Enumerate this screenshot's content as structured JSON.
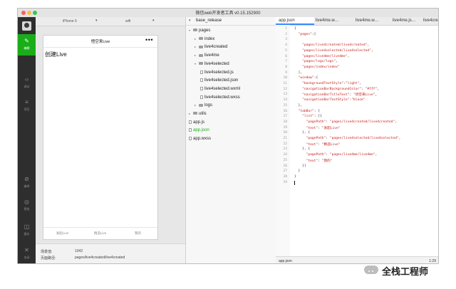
{
  "window": {
    "title": "微信web开发者工具 v0.15.152900"
  },
  "leftbar": {
    "items": [
      {
        "icon": "edit-icon",
        "label": "编辑",
        "glyph": "✎",
        "active": true
      },
      {
        "icon": "code-icon",
        "label": "调试",
        "glyph": "‹›",
        "active": false
      },
      {
        "icon": "menu-icon",
        "label": "项目",
        "glyph": "≡",
        "active": false
      },
      {
        "icon": "compile-icon",
        "label": "编译",
        "glyph": "⊘",
        "active": false
      },
      {
        "icon": "preview-icon",
        "label": "预览",
        "glyph": "◎",
        "active": false
      },
      {
        "icon": "layers-icon",
        "label": "缓存",
        "glyph": "◫",
        "active": false
      },
      {
        "icon": "close-icon",
        "label": "关闭",
        "glyph": "✕",
        "active": false
      }
    ]
  },
  "simulator": {
    "device": "iPhone 6",
    "network": "wifi",
    "nav_title": "悟空来Live",
    "nav_dots": "•••",
    "page_text": "创建Live",
    "tabs": [
      "发起Live",
      "精选Live",
      "我的"
    ]
  },
  "status": {
    "scene_label": "场景值:",
    "scene_value": "1042",
    "path_label": "页面路径:",
    "path_value": "pages/live4created/live4created"
  },
  "tree": {
    "root": "base_release",
    "items": [
      {
        "label": "pages",
        "type": "folder",
        "open": true,
        "depth": 0,
        "selected": false
      },
      {
        "label": "index",
        "type": "folder",
        "open": false,
        "depth": 1,
        "selected": false
      },
      {
        "label": "live4created",
        "type": "folder",
        "open": false,
        "depth": 1,
        "selected": false
      },
      {
        "label": "live4me",
        "type": "folder",
        "open": false,
        "depth": 1,
        "selected": false
      },
      {
        "label": "live4selected",
        "type": "folder",
        "open": true,
        "depth": 1,
        "selected": false
      },
      {
        "label": "live4selected.js",
        "type": "file",
        "open": false,
        "depth": 2,
        "selected": false
      },
      {
        "label": "live4selected.json",
        "type": "file",
        "open": false,
        "depth": 2,
        "selected": false
      },
      {
        "label": "live4selected.wxml",
        "type": "file",
        "open": false,
        "depth": 2,
        "selected": false
      },
      {
        "label": "live4selected.wxss",
        "type": "file",
        "open": false,
        "depth": 2,
        "selected": false
      },
      {
        "label": "logs",
        "type": "folder",
        "open": false,
        "depth": 1,
        "selected": false
      },
      {
        "label": "utils",
        "type": "folder",
        "open": false,
        "depth": 0,
        "selected": false
      },
      {
        "label": "app.js",
        "type": "file",
        "open": false,
        "depth": 0,
        "selected": false
      },
      {
        "label": "app.json",
        "type": "file",
        "open": false,
        "depth": 0,
        "selected": true
      },
      {
        "label": "app.wxss",
        "type": "file",
        "open": false,
        "depth": 0,
        "selected": false
      }
    ]
  },
  "editor": {
    "tabs": [
      "app.json",
      "live4me.w…",
      "live4me.w…",
      "live4me.js…",
      "live4created"
    ],
    "active_tab": 0,
    "lines": [
      "{",
      "  \"pages\":[",
      "",
      "    \"pages/live4created/live4created\",",
      "    \"pages/live4selected/live4selected\",",
      "    \"pages/live4me/live4me\",",
      "    \"pages/logs/logs\",",
      "    \"pages/index/index\"",
      "  ],",
      "  \"window\":{",
      "    \"backgroundTextStyle\":\"light\",",
      "    \"navigationBarBackgroundColor\": \"#fff\",",
      "    \"navigationBarTitleText\": \"悟空来Live\",",
      "    \"navigationBarTextStyle\":\"black\"",
      "  },",
      "  \"tabBar\": {",
      "    \"list\": [{",
      "      \"pagePath\": \"pages/live4created/live4created\",",
      "      \"text\": \"发起Live\"",
      "    }, {",
      "      \"pagePath\": \"pages/live4selected/live4selected\",",
      "      \"text\": \"精选Live\"",
      "    }, {",
      "      \"pagePath\": \"pages/live4me/live4me\",",
      "      \"text\": \"我的\"",
      "    }]",
      "  }",
      "}",
      ""
    ],
    "status_file": "app.json",
    "status_pos": "1:29"
  },
  "watermark": {
    "text": "全栈工程师"
  },
  "colors": {
    "accent_green": "#1aad19",
    "tab_blue": "#3a89ff",
    "string_red": "#c41a16"
  }
}
